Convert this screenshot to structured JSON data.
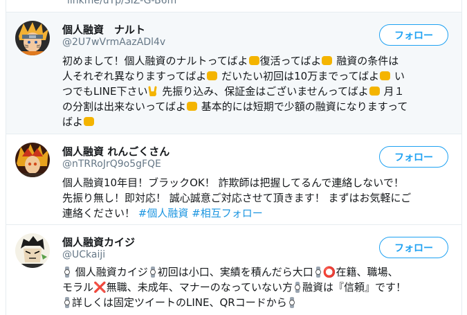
{
  "top_partial": "linkme/uTp/SIZ-G-B6m",
  "users": [
    {
      "name": "個人融資　ナルト",
      "handle": "@2U7wVrmAazADl4v",
      "follow_label": "フォロー",
      "avatar": "naruto-avatar",
      "bio": {
        "l1a": "初めまして！個人融資のナルトってばよ",
        "l1b": "復活ってばよ",
        "l1c": " 融資の条件は",
        "l2a": "人それぞれ異なりますってばよ",
        "l2b": " だいたい初回は10万までってばよ",
        "l2c": " い",
        "l3a": "つでもLINE下さい",
        "l3b": " 先振り込み、保証金はございませんってばよ",
        "l3c": " 月１",
        "l4a": "の分割は出来ないってばよ",
        "l4b": " 基本的には短期で少額の融資になりますって",
        "l5a": "ばよ"
      }
    },
    {
      "name": "個人融資 れんごくさん",
      "handle": "@nTRRoJrQ9o5gFQE",
      "follow_label": "フォロー",
      "avatar": "rengoku-avatar",
      "bio": {
        "l1": "個人融資10年目！ブラックOK！ 詐欺師は把握してるんで連絡しないで！",
        "l2": "先振り無し！即対応！ 誠心誠意ご対応させて頂きます！ まずはお気軽にご",
        "l3a": "連絡ください！ ",
        "tag1": "#個人融資",
        "tag2": "#相互フォロー"
      }
    },
    {
      "name": "個人融資カイジ",
      "handle": "@UCkaiji",
      "follow_label": "フォロー",
      "avatar": "kaiji-avatar",
      "bio": {
        "l1a": " 個人融資カイジ",
        "l1b": "初回は小口、実績を積んだら大口",
        "l1c": "在籍、職場、",
        "l2a": "モラル",
        "l2b": "無職、未成年、マナーのなっていない方",
        "l2c": "融資は『信頼』です！",
        "l3a": "詳しくは固定ツイートのLINE、QRコードから"
      }
    }
  ],
  "colors": {
    "accent": "#1da1f2",
    "highlight_bg": "#f5f8fa",
    "handle": "#657786"
  }
}
